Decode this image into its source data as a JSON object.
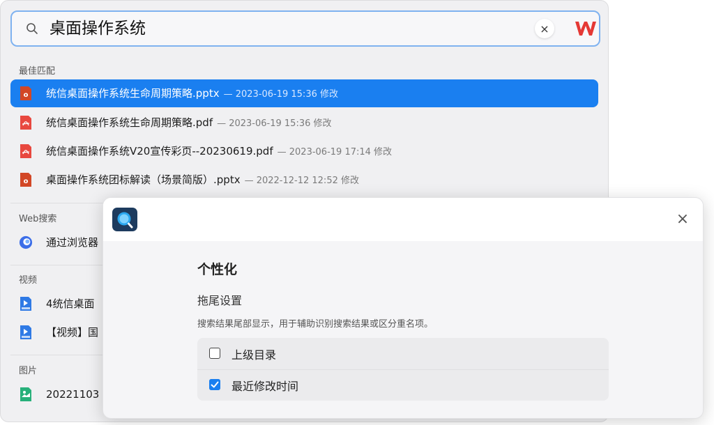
{
  "search": {
    "query": "桌面操作系统",
    "clear_symbol": "×"
  },
  "groups": {
    "best_match": "最佳匹配",
    "web": "Web搜索",
    "video": "视频",
    "image": "图片"
  },
  "best_match": [
    {
      "name": "统信桌面操作系统生命周期策略.pptx",
      "meta": "— 2023-06-19 15:36 修改",
      "type": "pptx"
    },
    {
      "name": "统信桌面操作系统生命周期策略.pdf",
      "meta": "— 2023-06-19 15:36 修改",
      "type": "pdf"
    },
    {
      "name": "统信桌面操作系统V20宣传彩页--20230619.pdf",
      "meta": "— 2023-06-19 17:14 修改",
      "type": "pdf"
    },
    {
      "name": "桌面操作系统团标解读（场景简版）.pptx",
      "meta": "— 2022-12-12 12:52 修改",
      "type": "pptx"
    }
  ],
  "web": [
    {
      "name": "通过浏览器"
    }
  ],
  "video": [
    {
      "name": "4统信桌面"
    },
    {
      "name": "【视频】国"
    }
  ],
  "image": [
    {
      "name": "20221103"
    }
  ],
  "dialog": {
    "section_title": "个性化",
    "sub_title": "拖尾设置",
    "description": "搜索结果尾部显示，用于辅助识别搜索结果或区分重名项。",
    "close_symbol": "×",
    "options": [
      {
        "label": "上级目录",
        "checked": false
      },
      {
        "label": "最近修改时间",
        "checked": true
      }
    ]
  },
  "colors": {
    "accent": "#1a7ff0",
    "pdf": "#e8483f",
    "pptx": "#d24726",
    "video": "#2f7ae5",
    "image": "#27b07a"
  }
}
